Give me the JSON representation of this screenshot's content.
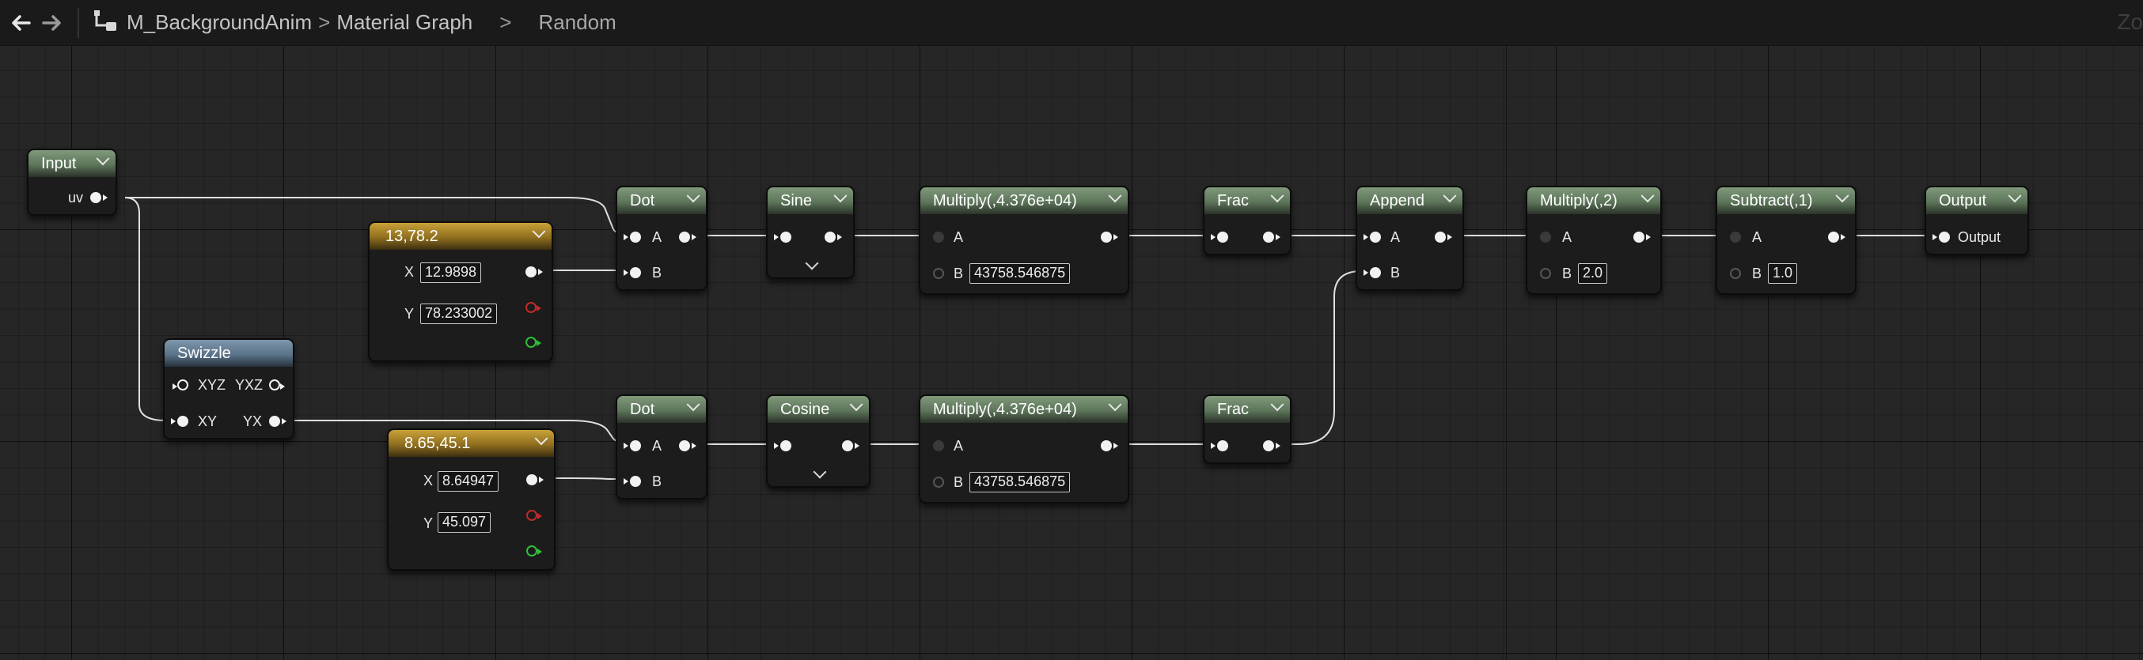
{
  "breadcrumb": {
    "items": [
      "M_BackgroundAnim",
      "Material Graph",
      "Random"
    ],
    "separator": ">"
  },
  "zoom_label": "Zo",
  "nodes": {
    "input": {
      "title": "Input",
      "out": "uv"
    },
    "swizzle": {
      "title": "Swizzle",
      "in1": "XYZ",
      "out1": "YXZ",
      "in2": "XY",
      "out2": "YX"
    },
    "const1": {
      "title": "13,78.2",
      "x_label": "X",
      "x_value": "12.9898",
      "y_label": "Y",
      "y_value": "78.233002"
    },
    "const2": {
      "title": "8.65,45.1",
      "x_label": "X",
      "x_value": "8.64947",
      "y_label": "Y",
      "y_value": "45.097"
    },
    "dot1": {
      "title": "Dot",
      "a": "A",
      "b": "B"
    },
    "dot2": {
      "title": "Dot",
      "a": "A",
      "b": "B"
    },
    "sine": {
      "title": "Sine"
    },
    "cosine": {
      "title": "Cosine"
    },
    "mul1": {
      "title": "Multiply(,4.376e+04)",
      "a": "A",
      "b": "B",
      "b_value": "43758.546875"
    },
    "mul2": {
      "title": "Multiply(,4.376e+04)",
      "a": "A",
      "b": "B",
      "b_value": "43758.546875"
    },
    "frac1": {
      "title": "Frac"
    },
    "frac2": {
      "title": "Frac"
    },
    "append": {
      "title": "Append",
      "a": "A",
      "b": "B"
    },
    "mul3": {
      "title": "Multiply(,2)",
      "a": "A",
      "b": "B",
      "b_value": "2.0"
    },
    "sub": {
      "title": "Subtract(,1)",
      "a": "A",
      "b": "B",
      "b_value": "1.0"
    },
    "output": {
      "title": "Output",
      "in": "Output"
    }
  },
  "colors": {
    "graph_bg": "#262626",
    "node_header_function": "#6f8a6a",
    "node_header_constant": "#b08a2c",
    "node_header_swizzle": "#6a839a",
    "wire": "#e0e0e0"
  }
}
